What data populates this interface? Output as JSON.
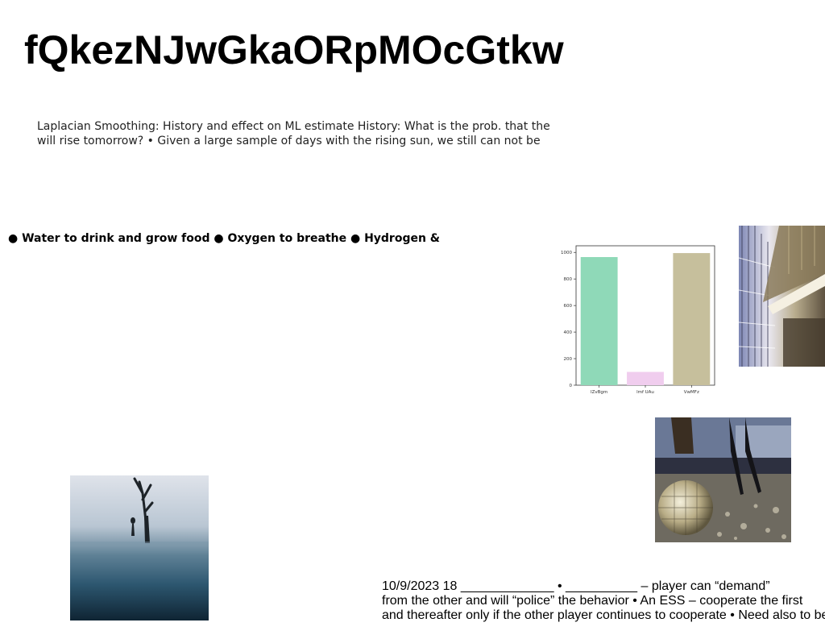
{
  "title": "fQkezNJwGkaORpMOcGtkw",
  "paragraph": {
    "lines": [
      "Laplacian Smoothing: History and effect on ML estimate History: What is the prob. that the",
      "will rise tomorrow? • Given a large sample of days with the rising sun, we still can not be"
    ]
  },
  "bullets": {
    "text": "● Water to drink and grow food ● Oxygen to breathe ● Hydrogen &"
  },
  "notes": {
    "lines": [
      "10/9/2023 18 _____________ • __________ – player can “demand”",
      "from the other  and will “police” the behavior • An ESS – cooperate the first",
      "and thereafter only if the other player continues to cooperate • Need also to be"
    ]
  },
  "chart_data": {
    "type": "bar",
    "categories": [
      "IZvBgm",
      "lmf UAu",
      "VwMFz"
    ],
    "values": [
      965,
      100,
      995
    ],
    "colors": [
      "#8fd9b8",
      "#f0cdee",
      "#c6bf9c"
    ],
    "ylim": [
      0,
      1050
    ],
    "yticks": [
      0,
      200,
      400,
      600,
      800,
      1000
    ],
    "grid": false
  },
  "images": {
    "building": "building-interior-photo",
    "disco": "disco-ball-photo",
    "tree": "foggy-tree-photo"
  }
}
